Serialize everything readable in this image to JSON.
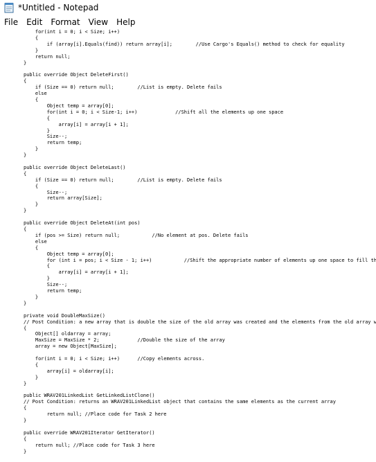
{
  "window": {
    "title": "*Untitled - Notepad",
    "icon": "notepad-icon"
  },
  "menu": {
    "items": [
      {
        "label": "File"
      },
      {
        "label": "Edit"
      },
      {
        "label": "Format"
      },
      {
        "label": "View"
      },
      {
        "label": "Help"
      }
    ]
  },
  "editor": {
    "lines": [
      "    for(int i = 0; i < Size; i++)",
      "    {",
      "        if (array[i].Equals(find)) return array[i];        //Use Cargo's Equals() method to check for equality",
      "    }",
      "    return null;",
      "}",
      "",
      "public override Object DeleteFirst()",
      "{",
      "    if (Size == 0) return null;        //List is empty. Delete fails",
      "    else",
      "    {",
      "        Object temp = array[0];",
      "        for(int i = 0; i < Size-1; i++)             //Shift all the elements up one space",
      "        {",
      "            array[i] = array[i + 1];",
      "        }",
      "        Size--;",
      "        return temp;",
      "    }",
      "}",
      "",
      "public override Object DeleteLast()",
      "{",
      "    if (Size == 0) return null;        //List is empty. Delete fails",
      "    {",
      "        Size--;",
      "        return array[Size];",
      "    }",
      "}",
      "",
      "public override Object DeleteAt(int pos)",
      "{",
      "    if (pos >= Size) return null;           //No element at pos. Delete fails",
      "    else",
      "    {",
      "        Object temp = array[0];",
      "        for (int i = pos; i < Size - 1; i++)           //Shift the appropriate number of elements up one space to fill the gap",
      "        {",
      "            array[i] = array[i + 1];",
      "        }",
      "        Size--;",
      "        return temp;",
      "    }",
      "}",
      "",
      "private void DoubleMaxSize()",
      "// Post Condition: a new array that is double the size of the old array was created and the elements from the old array was copied",
      "{",
      "    Object[] oldarray = array;",
      "    MaxSize = MaxSize * 2;             //Double the size of the array",
      "    array = new Object[MaxSize];",
      "",
      "    for(int i = 0; i < Size; i++)      //Copy elements across.",
      "    {",
      "        array[i] = oldarray[i];",
      "    }",
      "}",
      "",
      "public WRAV201LinkedList GetLinkedListClone()",
      "// Post Condition: returns an WRAV201LinkedList object that contains the same elements as the current array",
      "{",
      "        return null; //Place code for Task 2 here",
      "}",
      "",
      "public override WRAV201Iterator GetIterator()",
      "{",
      "    return null; //Place code for Task 3 here",
      "}"
    ]
  }
}
